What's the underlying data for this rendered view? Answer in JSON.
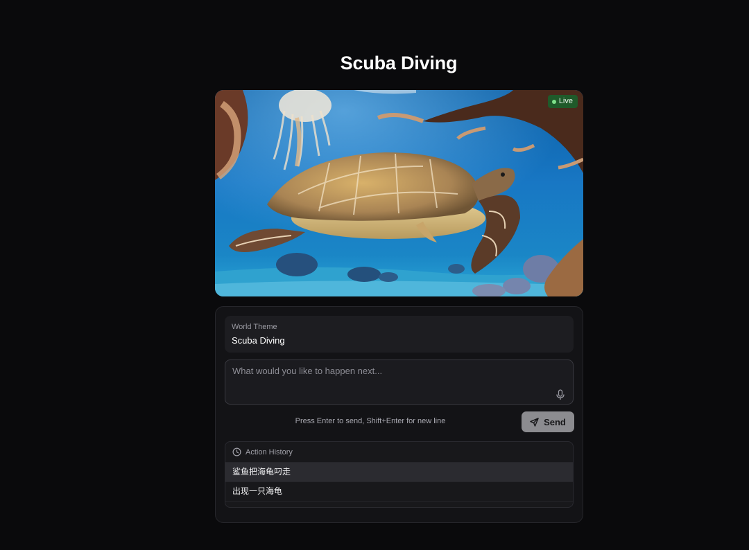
{
  "page": {
    "title": "Scuba Diving"
  },
  "viewer": {
    "live_label": "Live",
    "image_subject": "sea-turtle-underwater-scene"
  },
  "world_theme": {
    "label": "World Theme",
    "value": "Scuba Diving"
  },
  "prompt": {
    "placeholder": "What would you like to happen next...",
    "value": "",
    "hint": "Press Enter to send, Shift+Enter for new line",
    "send_label": "Send"
  },
  "history": {
    "title": "Action History",
    "items": [
      {
        "label": "鲨鱼把海龟叼走",
        "active": true
      },
      {
        "label": "出现一只海龟",
        "active": false
      }
    ]
  },
  "colors": {
    "background": "#0a0a0c",
    "panel": "#131316",
    "live_badge": "#1f5a2a",
    "send_button": "#8c8c90"
  }
}
